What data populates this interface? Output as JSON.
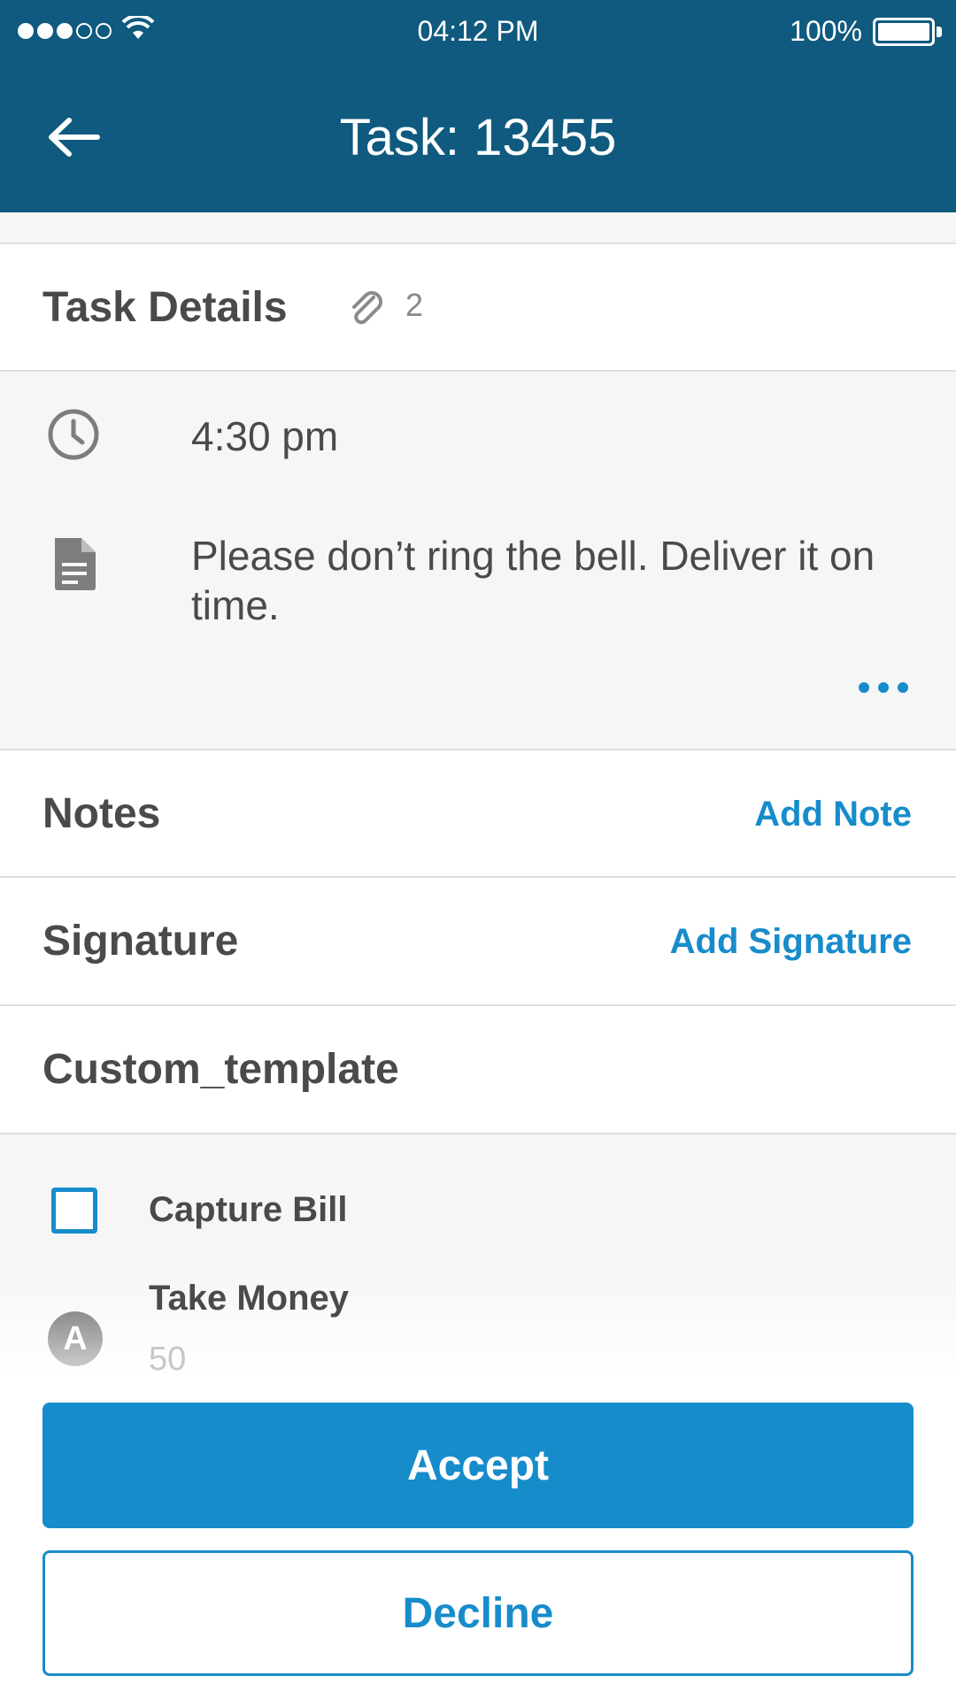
{
  "status_bar": {
    "time": "04:12 PM",
    "battery": "100%"
  },
  "header": {
    "title": "Task: 13455"
  },
  "task_details": {
    "title": "Task Details",
    "attachment_count": "2",
    "time": "4:30 pm",
    "note": "Please don’t ring the bell. Deliver it on time."
  },
  "notes": {
    "title": "Notes",
    "action": "Add Note"
  },
  "signature": {
    "title": "Signature",
    "action": "Add Signature"
  },
  "custom_template": {
    "title": "Custom_template",
    "checkbox_label": "Capture Bill",
    "money_label": "Take Money",
    "money_value": "50",
    "avatar_letter": "A"
  },
  "actions": {
    "accept": "Accept",
    "decline": "Decline"
  },
  "colors": {
    "header": "#0f5a7e",
    "accent": "#178ccb",
    "text": "#4a4a4a",
    "panel": "#f6f6f6"
  }
}
